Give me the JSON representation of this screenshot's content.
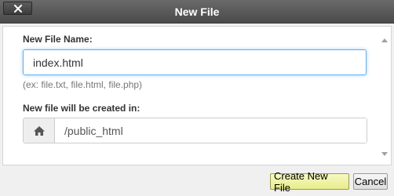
{
  "dialog": {
    "title": "New File",
    "close_icon": "close-icon"
  },
  "form": {
    "file_name_label": "New File Name:",
    "file_name_value": "index.html",
    "file_name_hint": "(ex: file.txt, file.html, file.php)",
    "directory_label": "New file will be created in:",
    "directory_icon": "home-icon",
    "directory_value": "/public_html"
  },
  "footer": {
    "create_label": "Create New File",
    "cancel_label": "Cancel"
  },
  "colors": {
    "titlebar": "#4a4a4a",
    "focus_border": "#66afe9",
    "create_button": "#e7ec8a"
  }
}
